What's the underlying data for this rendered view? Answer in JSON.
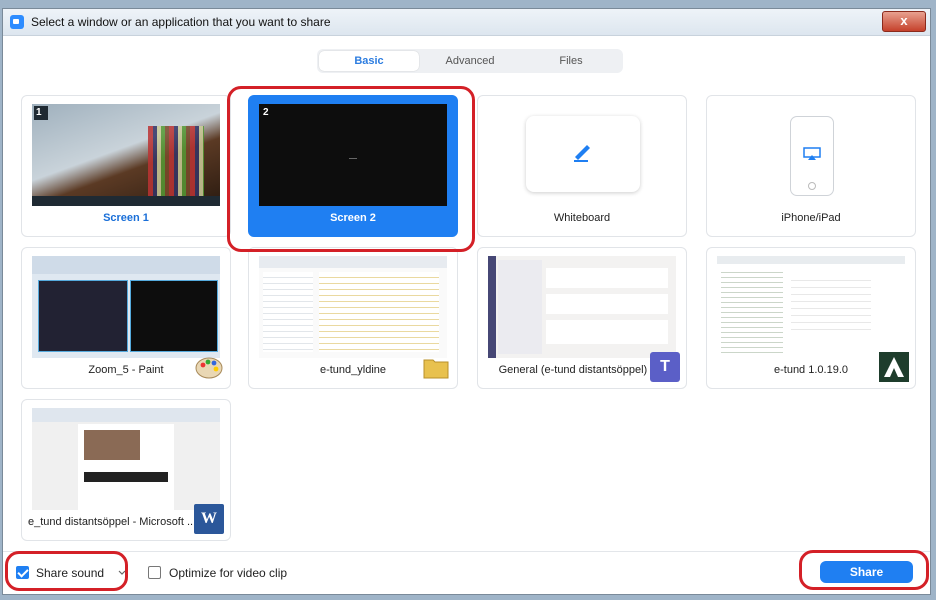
{
  "window": {
    "title": "Select a window or an application that you want to share",
    "close_label": "x"
  },
  "tabs": [
    {
      "label": "Basic",
      "active": true
    },
    {
      "label": "Advanced",
      "active": false
    },
    {
      "label": "Files",
      "active": false
    }
  ],
  "tiles": [
    {
      "label": "Screen 1",
      "badge": "1",
      "icon": "monitor-thumbnail"
    },
    {
      "label": "Screen 2",
      "badge": "2",
      "icon": "monitor-thumbnail",
      "selected": true
    },
    {
      "label": "Whiteboard",
      "icon": "pen-icon"
    },
    {
      "label": "iPhone/iPad",
      "icon": "airplay-icon"
    },
    {
      "label": "Zoom_5 - Paint",
      "icon": "paint-palette-icon"
    },
    {
      "label": "e-tund_yldine",
      "icon": "folder-icon"
    },
    {
      "label": "General (e-tund distantsöppel) | ...",
      "icon": "teams-icon",
      "icon_letter": "T"
    },
    {
      "label": "e-tund 1.0.19.0",
      "icon": "etund-app-icon"
    },
    {
      "label": "e_tund distantsöppel - Microsoft ...",
      "icon": "word-icon",
      "icon_letter": "W"
    }
  ],
  "bottom": {
    "share_sound": {
      "label": "Share sound",
      "checked": true
    },
    "optimize": {
      "label": "Optimize for video clip",
      "checked": false
    },
    "share_button": "Share"
  },
  "colors": {
    "accent": "#1f7ff2",
    "highlight": "#d42027"
  }
}
